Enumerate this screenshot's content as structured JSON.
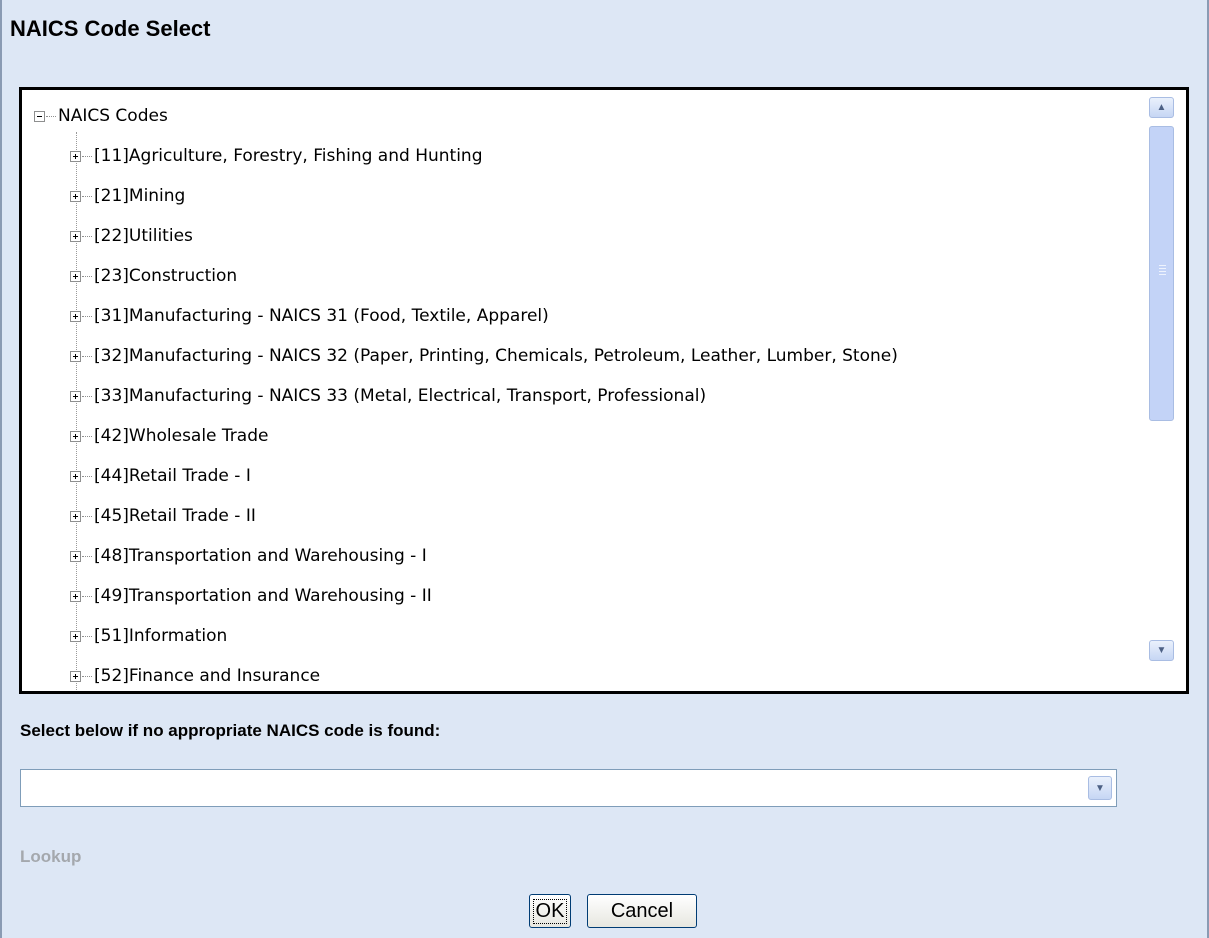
{
  "title": "NAICS Code Select",
  "tree": {
    "root_label": "NAICS Codes",
    "items": [
      "[11]Agriculture, Forestry, Fishing and Hunting",
      "[21]Mining",
      "[22]Utilities",
      "[23]Construction",
      "[31]Manufacturing - NAICS 31 (Food, Textile, Apparel)",
      "[32]Manufacturing - NAICS 32 (Paper, Printing, Chemicals, Petroleum, Leather, Lumber, Stone)",
      "[33]Manufacturing - NAICS 33 (Metal, Electrical, Transport, Professional)",
      "[42]Wholesale Trade",
      "[44]Retail Trade - I",
      "[45]Retail Trade - II",
      "[48]Transportation and Warehousing - I",
      "[49]Transportation and Warehousing - II",
      "[51]Information",
      "[52]Finance and Insurance"
    ]
  },
  "fallback": {
    "label": "Select below if no appropriate NAICS code is found:",
    "selected_value": ""
  },
  "lookup_label": "Lookup",
  "buttons": {
    "ok": "OK",
    "cancel": "Cancel"
  },
  "icons": {
    "expand": "plus-box-icon",
    "collapse": "minus-box-icon",
    "scroll_up": "arrow-up-icon",
    "scroll_down": "arrow-down-icon",
    "dropdown": "chevron-down-icon"
  }
}
